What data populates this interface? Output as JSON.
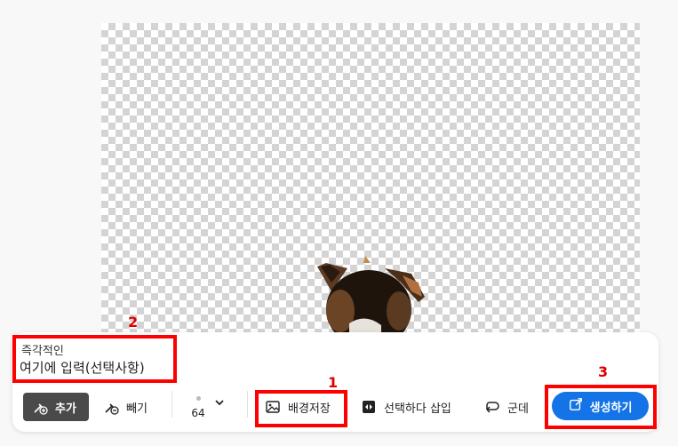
{
  "prompt": {
    "label": "즉각적인",
    "placeholder": "여기에 입력(선택사항)"
  },
  "toolbar": {
    "add_label": "추가",
    "subtract_label": "빼기",
    "brush_size": "64",
    "save_background_label": "배경저장",
    "insert_selection_label": "선택하다 삽입",
    "undo_label": "군데",
    "generate_label": "생성하기"
  },
  "annotations": {
    "marker_1": "1",
    "marker_2": "2",
    "marker_3": "3"
  },
  "colors": {
    "primary": "#1473e6",
    "highlight": "#ff0000",
    "add_button_bg": "#4a4a4a"
  }
}
